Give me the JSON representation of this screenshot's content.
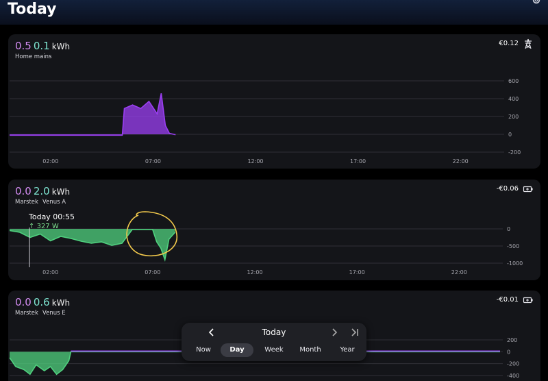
{
  "header": {
    "title": "Today",
    "settings_icon": "gear-icon"
  },
  "cards": [
    {
      "import_value": "0.5",
      "export_value": "0.1",
      "unit": "kWh",
      "labels": [
        "Home mains"
      ],
      "cost": "€0.12",
      "icon": "power-pylon-icon",
      "accent": "#9b3ff3"
    },
    {
      "import_value": "0.0",
      "export_value": "2.0",
      "unit": "kWh",
      "labels": [
        "Marstek",
        "Venus A"
      ],
      "cost": "-€0.06",
      "icon": "battery-icon",
      "accent": "#4fd07e",
      "tooltip": {
        "time": "Today 00:55",
        "value": "327 W",
        "arrow": "arrow-up-icon"
      }
    },
    {
      "import_value": "0.0",
      "export_value": "0.6",
      "unit": "kWh",
      "labels": [
        "Marstek",
        "Venus E"
      ],
      "cost": "-€0.01",
      "icon": "battery-icon",
      "accent": "#4fd07e"
    }
  ],
  "chart_data": [
    {
      "type": "area",
      "x_ticks": [
        "02:00",
        "07:00",
        "12:00",
        "17:00",
        "22:00"
      ],
      "y_ticks": [
        "600",
        "400",
        "200",
        "0",
        "-200"
      ],
      "ylim": [
        -200,
        600
      ],
      "x_range_hours": [
        0,
        24
      ],
      "series": [
        {
          "color": "#9b3ff3",
          "x": [
            0,
            1,
            2,
            3,
            4,
            5.5,
            5.6,
            6.0,
            6.4,
            6.8,
            7.2,
            7.4,
            7.6,
            7.8,
            8.1
          ],
          "y": [
            -10,
            -10,
            -10,
            -10,
            -10,
            -10,
            290,
            330,
            290,
            370,
            230,
            460,
            100,
            10,
            -5
          ]
        }
      ]
    },
    {
      "type": "area",
      "x_ticks": [
        "02:00",
        "07:00",
        "12:00",
        "17:00",
        "22:00"
      ],
      "y_ticks": [
        "0",
        "-500",
        "-1000"
      ],
      "ylim": [
        -1000,
        100
      ],
      "x_range_hours": [
        0,
        24
      ],
      "series": [
        {
          "color": "#4fd07e",
          "x": [
            0,
            0.5,
            1.0,
            1.5,
            2.0,
            2.5,
            3.0,
            3.5,
            4.0,
            4.5,
            5.0,
            5.5,
            5.8,
            6.0,
            6.5,
            7.0,
            7.2,
            7.4,
            7.6,
            7.8,
            8.1
          ],
          "y": [
            -50,
            -100,
            -250,
            -150,
            -350,
            -220,
            -280,
            -360,
            -420,
            -380,
            -480,
            -420,
            -180,
            -20,
            -20,
            -20,
            -380,
            -560,
            -900,
            -300,
            -100
          ]
        }
      ]
    },
    {
      "type": "area",
      "x_ticks": [],
      "y_ticks": [
        "200",
        "0",
        "-200",
        "-400"
      ],
      "ylim": [
        -400,
        200
      ],
      "x_range_hours": [
        0,
        24
      ],
      "series": [
        {
          "color": "#4fd07e",
          "x": [
            0,
            0.3,
            0.7,
            1.0,
            1.3,
            1.7,
            2.0,
            2.3,
            2.6,
            2.9,
            3.0,
            24
          ],
          "y": [
            -100,
            -250,
            -300,
            -380,
            -220,
            -320,
            -250,
            -380,
            -300,
            -150,
            0,
            0
          ]
        }
      ]
    }
  ],
  "nav": {
    "label": "Today",
    "prev_icon": "chevron-left-icon",
    "next_icon": "chevron-right-icon",
    "last_icon": "skip-to-end-icon",
    "tabs": [
      {
        "label": "Now",
        "active": false
      },
      {
        "label": "Day",
        "active": true
      },
      {
        "label": "Week",
        "active": false
      },
      {
        "label": "Month",
        "active": false
      },
      {
        "label": "Year",
        "active": false
      }
    ]
  }
}
